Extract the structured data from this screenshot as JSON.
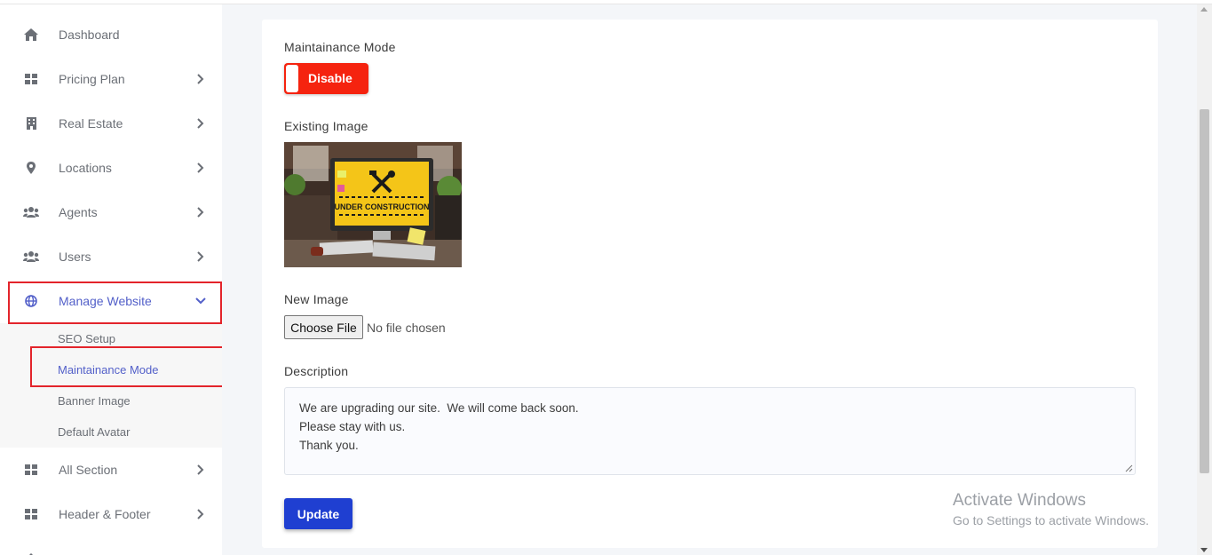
{
  "sidebar": {
    "items": [
      {
        "label": "Dashboard",
        "icon": "home-icon"
      },
      {
        "label": "Pricing Plan",
        "icon": "grid-icon"
      },
      {
        "label": "Real Estate",
        "icon": "building-icon"
      },
      {
        "label": "Locations",
        "icon": "map-marker-icon"
      },
      {
        "label": "Agents",
        "icon": "users-icon"
      },
      {
        "label": "Users",
        "icon": "users-icon"
      },
      {
        "label": "Manage Website",
        "icon": "globe-icon"
      },
      {
        "label": "All Section",
        "icon": "grid-icon"
      },
      {
        "label": "Header & Footer",
        "icon": "grid-icon"
      }
    ],
    "sub_items": [
      {
        "label": "SEO Setup"
      },
      {
        "label": "Maintainance Mode"
      },
      {
        "label": "Banner Image"
      },
      {
        "label": "Default Avatar"
      }
    ]
  },
  "form": {
    "mode_label": "Maintainance Mode",
    "toggle_label": "Disable",
    "existing_image_label": "Existing Image",
    "image_text": "UNDER CONSTRUCTION",
    "new_image_label": "New Image",
    "choose_file_label": "Choose File",
    "file_status": "No file chosen",
    "description_label": "Description",
    "description_lines": [
      "We are upgrading our site.  We will come back soon.",
      "Please stay with us.",
      "Thank you."
    ],
    "update_label": "Update"
  },
  "watermark": {
    "title": "Activate Windows",
    "subtitle": "Go to Settings to activate Windows."
  },
  "colors": {
    "accent": "#5360c9",
    "toggle_off": "#f5230f",
    "primary_button": "#1f3fd1",
    "highlight_box": "#e3242b"
  }
}
